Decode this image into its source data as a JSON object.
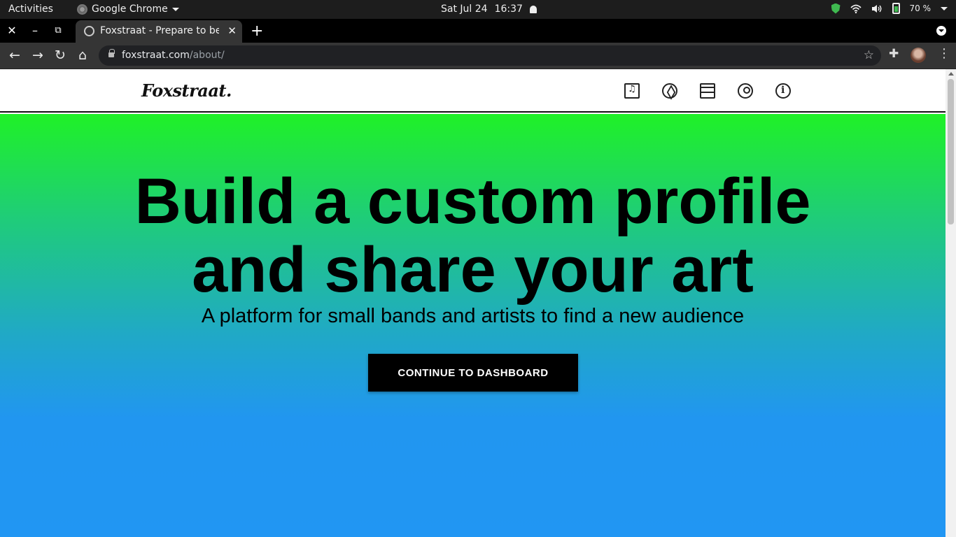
{
  "system_bar": {
    "activities": "Activities",
    "app_name": "Google Chrome",
    "date": "Sat Jul 24",
    "time": "16:37",
    "battery": "70 %"
  },
  "browser": {
    "tab_title": "Foxstraat - Prepare to be amazed",
    "url_domain": "foxstraat.com",
    "url_path": "/about/"
  },
  "site": {
    "logo": "Foxstraat.",
    "nav_icons": [
      "library-music-icon",
      "explore-compass-icon",
      "storefront-icon",
      "account-circle-icon",
      "info-icon"
    ]
  },
  "hero": {
    "headline_line1": "Build a custom profile",
    "headline_line2": "and share your art",
    "subline": "A platform for small bands and artists to find a new audience",
    "cta": "CONTINUE TO DASHBOARD"
  },
  "colors": {
    "gradient_top": "#1ff127",
    "gradient_bottom": "#2196f3",
    "cta_bg": "#000000"
  }
}
